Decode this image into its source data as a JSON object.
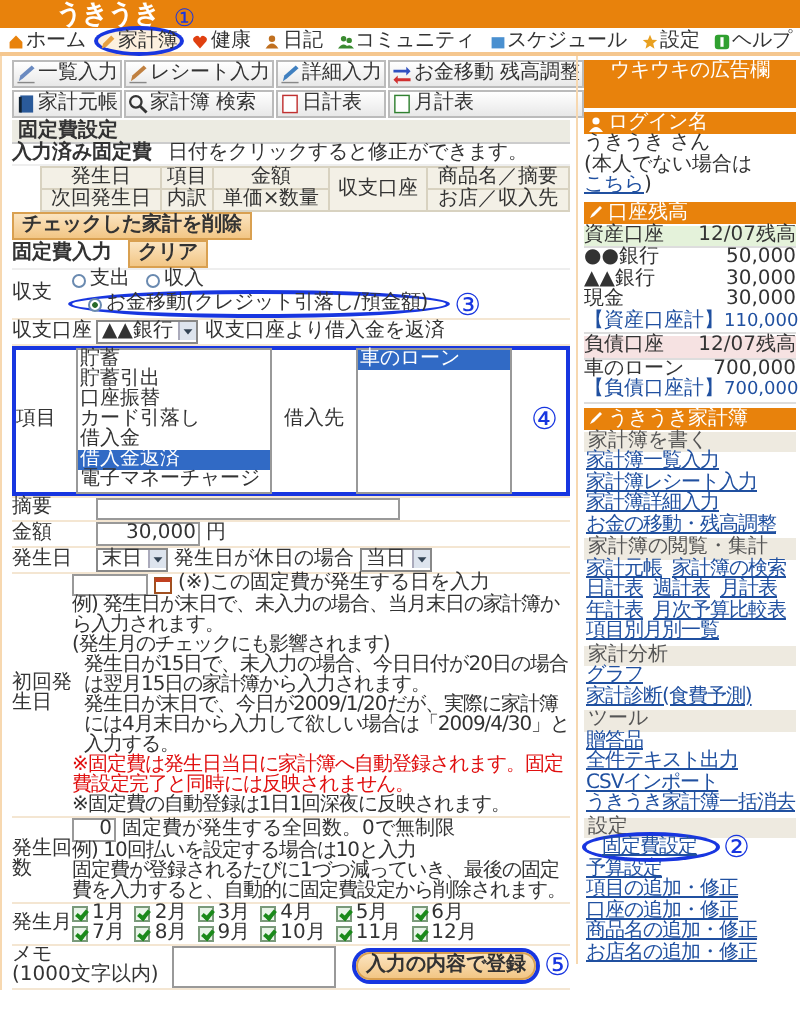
{
  "header": {
    "logo": "うきうき",
    "nav": [
      {
        "label": "ホーム",
        "selected": false
      },
      {
        "label": "家計簿",
        "selected": true,
        "callout": "①"
      },
      {
        "label": "健康",
        "selected": false
      },
      {
        "label": "日記",
        "selected": false
      },
      {
        "label": "コミュニティ",
        "selected": false
      },
      {
        "label": "スケジュール",
        "selected": false
      },
      {
        "label": "設定",
        "selected": false
      },
      {
        "label": "ヘルプ",
        "selected": false
      }
    ]
  },
  "main": {
    "toolbar": [
      {
        "lines": [
          "一覧入力"
        ]
      },
      {
        "lines": [
          "レシート入力"
        ]
      },
      {
        "lines": [
          "詳細入力"
        ]
      },
      {
        "lines": [
          "お金移動",
          "残高調整"
        ]
      },
      {
        "lines": [
          "家計元帳"
        ]
      },
      {
        "lines": [
          "家計簿",
          "検索"
        ]
      },
      {
        "lines": [
          "日計表"
        ]
      },
      {
        "lines": [
          "月計表"
        ]
      }
    ],
    "title": "固定費設定",
    "registered": {
      "heading": "入力済み固定費",
      "hint": "日付をクリックすると修正ができます。",
      "columns": [
        [
          "発生日",
          "次回発生日"
        ],
        [
          "項目",
          "内訳"
        ],
        [
          "金額",
          "単価×数量"
        ],
        [
          "収支口座"
        ],
        [
          "商品名／摘要",
          "お店／収入先"
        ]
      ]
    },
    "delete_button": "チェックした家計を削除",
    "input_heading": "固定費入力",
    "clear_button": "クリア",
    "rows": [
      {
        "kind": "radios",
        "label": "収支",
        "options": [
          {
            "label": "支出",
            "selected": false
          },
          {
            "label": "収入",
            "selected": false
          },
          {
            "label": "お金移動(クレジット引落し/預金額)",
            "selected": true,
            "callout": "③"
          }
        ]
      },
      {
        "kind": "account",
        "label": "収支口座",
        "value": "▲▲銀行",
        "note": "収支口座より借入金を返済"
      },
      {
        "kind": "lists",
        "label": "項目",
        "callout": "④",
        "items": [
          {
            "label": "貯蓄",
            "selected": false
          },
          {
            "label": "貯蓄引出",
            "selected": false
          },
          {
            "label": "口座振替",
            "selected": false
          },
          {
            "label": "カード引落し",
            "selected": false
          },
          {
            "label": "借入金",
            "selected": false
          },
          {
            "label": "借入金返済",
            "selected": true
          },
          {
            "label": "電子マネーチャージ",
            "selected": false
          }
        ],
        "target_label": "借入先",
        "targets": [
          {
            "label": "車のローン",
            "selected": true
          }
        ]
      },
      {
        "kind": "text",
        "label": "摘要"
      },
      {
        "kind": "amount",
        "label": "金額",
        "value": "30,000",
        "unit": "円"
      },
      {
        "kind": "day",
        "label": "発生日",
        "value": "末日",
        "holiday_label": "発生日が休日の場合",
        "holiday_value": "当日"
      },
      {
        "kind": "firstdate",
        "label": "初回発生日",
        "note": "(※)この固定費が発生する日を入力",
        "lines": [
          {
            "kind": "plain",
            "text": "例) 発生日が末日で、未入力の場合、当月末日の家計簿から入力されます。"
          },
          {
            "kind": "plain",
            "text": "(発生月のチェックにも影響されます)"
          },
          {
            "kind": "indent",
            "text": "発生日が15日で、未入力の場合、今日日付が20日の場合は翌月15日の家計簿から入力されます。"
          },
          {
            "kind": "indent",
            "text": "発生日が末日で、今日が2009/1/20だが、実際に家計簿には4月末日から入力して欲しい場合は「2009/4/30」と入力する。"
          },
          {
            "kind": "warning",
            "text": "※固定費は発生日当日に家計簿へ自動登録されます。固定費設定完了と同時には反映されません。"
          },
          {
            "kind": "plain",
            "text": "※固定費の自動登録は1日1回深夜に反映されます。"
          }
        ]
      },
      {
        "kind": "count",
        "label": "発生回数",
        "value": "0",
        "note": "固定費が発生する全回数。0で無制限",
        "lines": [
          {
            "kind": "plain",
            "text": "例) 10回払いを設定する場合は10と入力"
          },
          {
            "kind": "plain",
            "text": "固定費が登録されるたびに1づつ減っていき、最後の固定費を入力すると、自動的に固定費設定から削除されます。"
          }
        ]
      },
      {
        "kind": "months",
        "label": "発生月",
        "months": [
          {
            "label": "1月",
            "checked": true
          },
          {
            "label": "2月",
            "checked": true
          },
          {
            "label": "3月",
            "checked": true
          },
          {
            "label": "4月",
            "checked": true
          },
          {
            "label": "5月",
            "checked": true
          },
          {
            "label": "6月",
            "checked": true
          },
          {
            "label": "7月",
            "checked": true
          },
          {
            "label": "8月",
            "checked": true
          },
          {
            "label": "9月",
            "checked": true
          },
          {
            "label": "10月",
            "checked": true
          },
          {
            "label": "11月",
            "checked": true
          },
          {
            "label": "12月",
            "checked": true
          }
        ]
      },
      {
        "kind": "memo",
        "label": "メモ",
        "sublabel": "(1000文字以内)"
      }
    ],
    "submit": {
      "label": "入力の内容で登録",
      "callout": "⑤"
    }
  },
  "sidebar": {
    "ad": "ウキウキの広告欄",
    "login": {
      "title": "ログイン名",
      "user": "うきうき さん",
      "note_before": "(本人でない場合は",
      "link": "こちら",
      "note_after": ")"
    },
    "balances": {
      "title": "口座残高",
      "groups": [
        {
          "kind": "asset",
          "heading": "資産口座",
          "date": "12/07残高",
          "rows": [
            {
              "name": "●●銀行",
              "amount": "50,000"
            },
            {
              "name": "▲▲銀行",
              "amount": "30,000"
            },
            {
              "name": "現金",
              "amount": "30,000"
            }
          ],
          "total": {
            "name": "【資産口座計】",
            "amount": "110,000"
          }
        },
        {
          "kind": "debt",
          "heading": "負債口座",
          "date": "12/07残高",
          "rows": [
            {
              "name": "車のローン",
              "amount": "700,000"
            }
          ],
          "total": {
            "name": "【負債口座計】",
            "amount": "700,000"
          }
        }
      ]
    },
    "menu": {
      "title": "うきうき家計簿",
      "sections": [
        {
          "heading": "家計簿を書く",
          "links": [
            {
              "label": "家計簿一覧入力"
            },
            {
              "label": "家計簿レシート入力"
            },
            {
              "label": "家計簿詳細入力"
            },
            {
              "label": "お金の移動・残高調整"
            }
          ]
        },
        {
          "heading": "家計簿の閲覧・集計",
          "links": [
            {
              "label": "家計元帳"
            },
            {
              "label": "家計簿の検索"
            },
            {
              "label": "日計表"
            },
            {
              "label": "週計表"
            },
            {
              "label": "月計表"
            },
            {
              "label": "年計表"
            },
            {
              "label": "月次予算比較表"
            },
            {
              "label": "項目別月別一覧"
            }
          ]
        },
        {
          "heading": "家計分析",
          "links": [
            {
              "label": "グラフ"
            },
            {
              "label": "家計診断(食費予測)"
            }
          ]
        },
        {
          "heading": "ツール",
          "links": [
            {
              "label": "贈答品"
            },
            {
              "label": "全件テキスト出力"
            },
            {
              "label": "CSVインポート"
            },
            {
              "label": "うきうき家計簿一括消去"
            }
          ]
        },
        {
          "heading": "設定",
          "links": [
            {
              "label": "固定費設定",
              "callout": "②"
            },
            {
              "label": "予算設定"
            },
            {
              "label": "項目の追加・修正"
            },
            {
              "label": "口座の追加・修正"
            },
            {
              "label": "商品名の追加・修正"
            },
            {
              "label": "お店名の追加・修正"
            }
          ]
        }
      ]
    }
  }
}
